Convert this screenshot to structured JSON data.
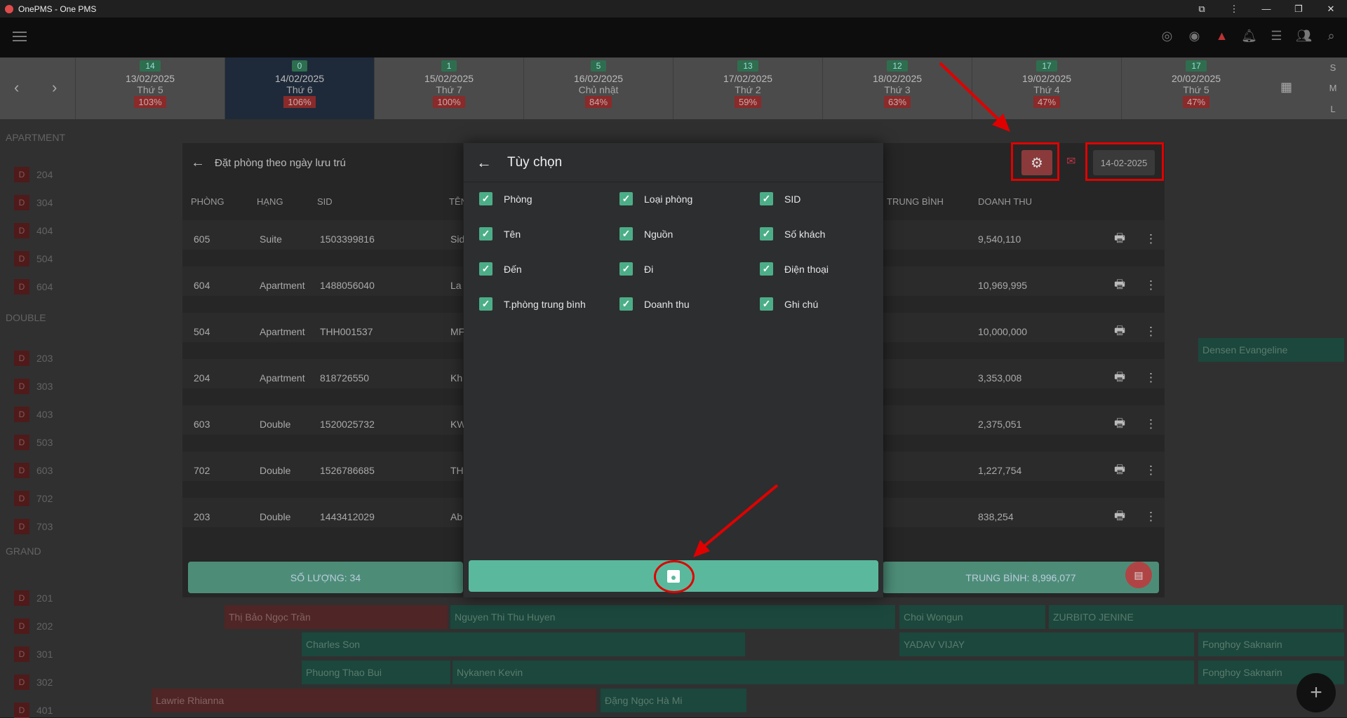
{
  "window": {
    "title": "OnePMS - One PMS"
  },
  "dates": [
    {
      "count": "14",
      "date": "13/02/2025",
      "weekday": "Thứ 5",
      "pct": "103%"
    },
    {
      "count": "0",
      "date": "14/02/2025",
      "weekday": "Thứ 6",
      "pct": "106%"
    },
    {
      "count": "1",
      "date": "15/02/2025",
      "weekday": "Thứ 7",
      "pct": "100%"
    },
    {
      "count": "5",
      "date": "16/02/2025",
      "weekday": "Chủ nhật",
      "pct": "84%"
    },
    {
      "count": "13",
      "date": "17/02/2025",
      "weekday": "Thứ 2",
      "pct": "59%"
    },
    {
      "count": "12",
      "date": "18/02/2025",
      "weekday": "Thứ 3",
      "pct": "63%"
    },
    {
      "count": "17",
      "date": "19/02/2025",
      "weekday": "Thứ 4",
      "pct": "47%"
    },
    {
      "count": "17",
      "date": "20/02/2025",
      "weekday": "Thứ 5",
      "pct": "47%"
    }
  ],
  "size_toggle": [
    "S",
    "M",
    "L"
  ],
  "sections": [
    "APARTMENT",
    "DOUBLE",
    "GRAND"
  ],
  "room_badge": "D",
  "rooms": [
    "204",
    "304",
    "404",
    "504",
    "604",
    "203",
    "303",
    "403",
    "503",
    "603",
    "702",
    "703",
    "201",
    "202",
    "301",
    "302",
    "401"
  ],
  "bookings": [
    "Thị Bảo Ngọc Trần",
    "Nguyen Thi Thu Huyen",
    "Choi Wongun",
    "ZURBITO JENINE",
    "Charles Son",
    "YADAV VIJAY",
    "Fonghoy Saknarin",
    "Phuong Thao Bui",
    "Nykanen Kevin",
    "Lawrie Rhianna",
    "Đặng Ngọc Hà Mi",
    "Densen Evangeline"
  ],
  "left_panel": {
    "title": "Đặt phòng theo ngày lưu trú",
    "columns": [
      "PHÒNG",
      "HẠNG",
      "SID",
      "TÊN"
    ],
    "rows": [
      {
        "room": "605",
        "type": "Suite",
        "sid": "1503399816",
        "name": "Sid"
      },
      {
        "room": "604",
        "type": "Apartment",
        "sid": "1488056040",
        "name": "La"
      },
      {
        "room": "504",
        "type": "Apartment",
        "sid": "THH001537",
        "name": "MF"
      },
      {
        "room": "204",
        "type": "Apartment",
        "sid": "818726550",
        "name": "Kh"
      },
      {
        "room": "603",
        "type": "Double",
        "sid": "1520025732",
        "name": "KW"
      },
      {
        "room": "702",
        "type": "Double",
        "sid": "1526786685",
        "name": "TH"
      },
      {
        "room": "203",
        "type": "Double",
        "sid": "1443412029",
        "name": "Ab"
      }
    ],
    "count_label": "SỐ LƯỢNG: 34"
  },
  "right_panel": {
    "date": "14-02-2025",
    "columns": [
      "TRUNG BÌNH",
      "DOANH THU"
    ],
    "revenues": [
      "9,540,110",
      "10,969,995",
      "10,000,000",
      "3,353,008",
      "2,375,051",
      "1,227,754",
      "838,254"
    ],
    "avg_label": "TRUNG BÌNH: 8,996,077"
  },
  "modal": {
    "title": "Tùy chọn",
    "options": [
      "Phòng",
      "Loại phòng",
      "SID",
      "Tên",
      "Nguồn",
      "Số khách",
      "Đến",
      "Đi",
      "Điện thoại",
      "T.phòng trung bình",
      "Doanh thu",
      "Ghi chú"
    ]
  },
  "colors": {
    "accent": "#5ab99c",
    "annotation": "#e00000",
    "danger": "#c0392b"
  }
}
